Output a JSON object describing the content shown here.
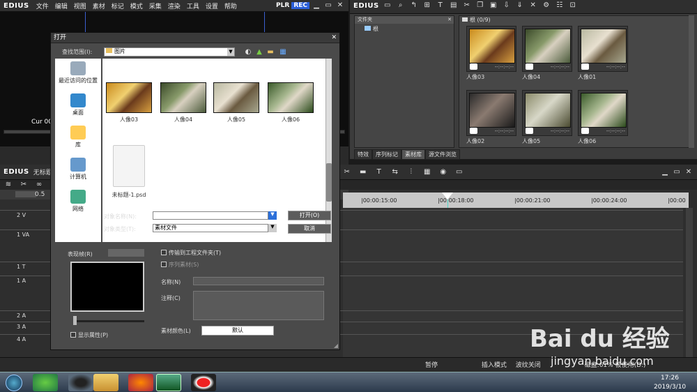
{
  "app": {
    "logo": "EDIUS",
    "menu": [
      "文件",
      "编辑",
      "视图",
      "素材",
      "标记",
      "模式",
      "采集",
      "渲染",
      "工具",
      "设置",
      "帮助"
    ],
    "plr": "PLR",
    "rec": "REC",
    "cur": "Cur 00"
  },
  "bin": {
    "logo": "EDIUS",
    "folder_header": "文件夹",
    "root": "根",
    "clip_header": "根 (0/9)",
    "clips": [
      {
        "label": "人像03"
      },
      {
        "label": "人像04"
      },
      {
        "label": "人像01"
      },
      {
        "label": "人像02"
      },
      {
        "label": "人像05"
      },
      {
        "label": "人像06"
      }
    ],
    "timecode": "--:--:--:--",
    "tabs": [
      "特效",
      "序列标记",
      "素材库",
      "源文件浏览"
    ]
  },
  "timeline": {
    "logo": "EDIUS",
    "title": "无标题",
    "zoom": "0.5",
    "ticks": [
      "|00:00:15:00",
      "|00:00:18:00",
      "|00:00:21:00",
      "|00:00:24:00",
      "|00:00"
    ],
    "tracks": [
      "2 V",
      "1 VA",
      "1 T",
      "1 A",
      "2 A",
      "3 A",
      "4 A"
    ]
  },
  "dialog": {
    "title": "打开",
    "lookin_label": "查找范围(I):",
    "lookin_value": "图片",
    "places": [
      "最近访问的位置",
      "桌面",
      "库",
      "计算机",
      "网络"
    ],
    "files": [
      {
        "label": "人像03"
      },
      {
        "label": "人像04"
      },
      {
        "label": "人像05"
      },
      {
        "label": "人像06"
      },
      {
        "label": "未标题-1.psd"
      }
    ],
    "name_label": "对象名称(N):",
    "name_value": "",
    "type_label": "对象类型(T):",
    "type_value": "素材文件",
    "open_btn": "打开(O)",
    "cancel_btn": "取消",
    "preview_label": "表现帧(R)",
    "show_props": "显示属性(P)",
    "transfer": "传输到工程文件夹(T)",
    "sequence": "序列素材(S)",
    "title_label": "名称(N)",
    "comment_label": "注释(C)",
    "color_label": "素材颜色(L)",
    "color_value": "默认"
  },
  "status": {
    "pause": "暂停",
    "insert": "插入模式",
    "ripple": "波纹关闭",
    "disk": "磁盘:61% 被使用(D:)"
  },
  "tray": {
    "time": "17:26",
    "date": "2019/3/10"
  },
  "watermark": {
    "brand": "Bai du 经验",
    "url": "jingyan.baidu.com"
  }
}
